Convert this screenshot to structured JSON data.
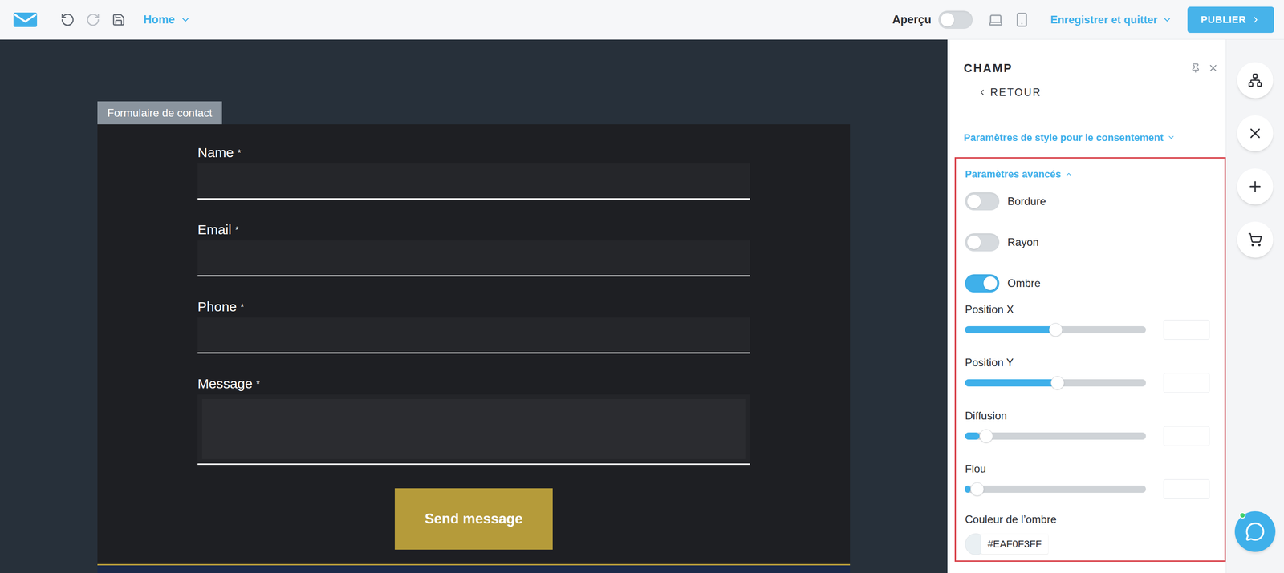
{
  "toolbar": {
    "page": "Home",
    "preview": {
      "label": "Aperçu",
      "on": false
    },
    "save": "Enregistrer et quitter",
    "publish": "PUBLIER"
  },
  "canvas": {
    "form_tab": "Formulaire de contact",
    "fields": [
      {
        "label": "Name",
        "required_mark": "*",
        "kind": "input"
      },
      {
        "label": "Email",
        "required_mark": "*",
        "kind": "input"
      },
      {
        "label": "Phone",
        "required_mark": "*",
        "kind": "input"
      },
      {
        "label": "Message",
        "required_mark": "*",
        "kind": "textarea"
      }
    ],
    "submit": "Send message"
  },
  "panel": {
    "title": "CHAMP",
    "back": "RETOUR",
    "consent_section": {
      "label": "Paramètres de style pour le consentement",
      "expanded": false
    },
    "advanced": {
      "label": "Paramètres avancés",
      "expanded": true,
      "highlighted": true,
      "toggles": [
        {
          "label": "Bordure",
          "on": false
        },
        {
          "label": "Rayon",
          "on": false
        },
        {
          "label": "Ombre",
          "on": true
        }
      ],
      "sliders": [
        {
          "label": "Position X",
          "level": 0.5
        },
        {
          "label": "Position Y",
          "level": 0.51
        },
        {
          "label": "Diffusion",
          "level": 0.08
        },
        {
          "label": "Flou",
          "level": 0.03
        }
      ],
      "shadow_color": {
        "label": "Couleur de l’ombre",
        "value": "#EAF0F3FF",
        "color": "#EAF0F3"
      }
    }
  }
}
